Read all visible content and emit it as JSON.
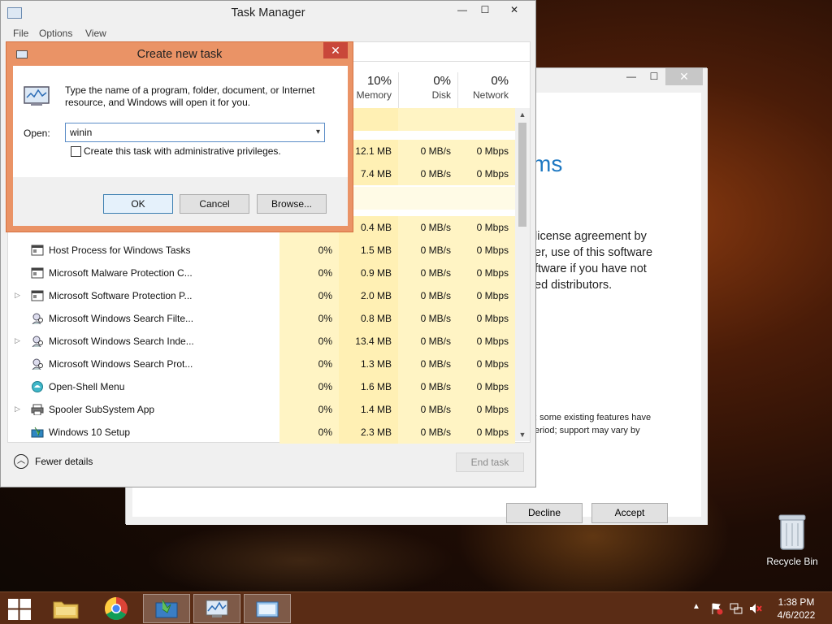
{
  "setup_window": {
    "heading": "ms",
    "paragraph": "license agreement by\ner, use of this software\nftware if you have not\ned distributors.",
    "note": "; some existing features have\neriod; support may vary by",
    "decline_label": "Decline",
    "accept_label": "Accept"
  },
  "task_manager": {
    "title": "Task Manager",
    "menu": [
      "File",
      "Options",
      "View"
    ],
    "columns": [
      {
        "pct": "10%",
        "name": "Memory"
      },
      {
        "pct": "0%",
        "name": "Disk"
      },
      {
        "pct": "0%",
        "name": "Network"
      }
    ],
    "rows_partial": [
      {
        "mem": "12.1 MB",
        "disk": "0 MB/s",
        "net": "0 Mbps"
      },
      {
        "mem": "7.4 MB",
        "disk": "0 MB/s",
        "net": "0 Mbps"
      },
      {
        "cpu": "",
        "mem": "0.4 MB",
        "disk": "0 MB/s",
        "net": "0 Mbps"
      }
    ],
    "rows": [
      {
        "name": "Host Process for Windows Tasks",
        "expand": "",
        "cpu": "0%",
        "mem": "1.5 MB",
        "disk": "0 MB/s",
        "net": "0 Mbps",
        "icon": "window-icon"
      },
      {
        "name": "Microsoft Malware Protection C...",
        "expand": "",
        "cpu": "0%",
        "mem": "0.9 MB",
        "disk": "0 MB/s",
        "net": "0 Mbps",
        "icon": "window-icon"
      },
      {
        "name": "Microsoft Software Protection P...",
        "expand": "▷",
        "cpu": "0%",
        "mem": "2.0 MB",
        "disk": "0 MB/s",
        "net": "0 Mbps",
        "icon": "window-icon"
      },
      {
        "name": "Microsoft Windows Search Filte...",
        "expand": "",
        "cpu": "0%",
        "mem": "0.8 MB",
        "disk": "0 MB/s",
        "net": "0 Mbps",
        "icon": "search-user-icon"
      },
      {
        "name": "Microsoft Windows Search Inde...",
        "expand": "▷",
        "cpu": "0%",
        "mem": "13.4 MB",
        "disk": "0 MB/s",
        "net": "0 Mbps",
        "icon": "search-user-icon"
      },
      {
        "name": "Microsoft Windows Search Prot...",
        "expand": "",
        "cpu": "0%",
        "mem": "1.3 MB",
        "disk": "0 MB/s",
        "net": "0 Mbps",
        "icon": "search-user-icon"
      },
      {
        "name": "Open-Shell Menu",
        "expand": "",
        "cpu": "0%",
        "mem": "1.6 MB",
        "disk": "0 MB/s",
        "net": "0 Mbps",
        "icon": "shell-icon"
      },
      {
        "name": "Spooler SubSystem App",
        "expand": "▷",
        "cpu": "0%",
        "mem": "1.4 MB",
        "disk": "0 MB/s",
        "net": "0 Mbps",
        "icon": "printer-icon"
      },
      {
        "name": "Windows 10 Setup",
        "expand": "",
        "cpu": "0%",
        "mem": "2.3 MB",
        "disk": "0 MB/s",
        "net": "0 Mbps",
        "icon": "setup-icon"
      }
    ],
    "fewer_details_label": "Fewer details",
    "end_task_label": "End task"
  },
  "create_task": {
    "title": "Create new task",
    "description": "Type the name of a program, folder, document, or Internet resource, and Windows will open it for you.",
    "open_label": "Open:",
    "open_value": "winin",
    "admin_label": "Create this task with administrative privileges.",
    "ok_label": "OK",
    "cancel_label": "Cancel",
    "browse_label": "Browse..."
  },
  "desktop": {
    "recycle_bin_label": "Recycle Bin"
  },
  "taskbar": {
    "time": "1:38 PM",
    "date": "4/6/2022"
  }
}
